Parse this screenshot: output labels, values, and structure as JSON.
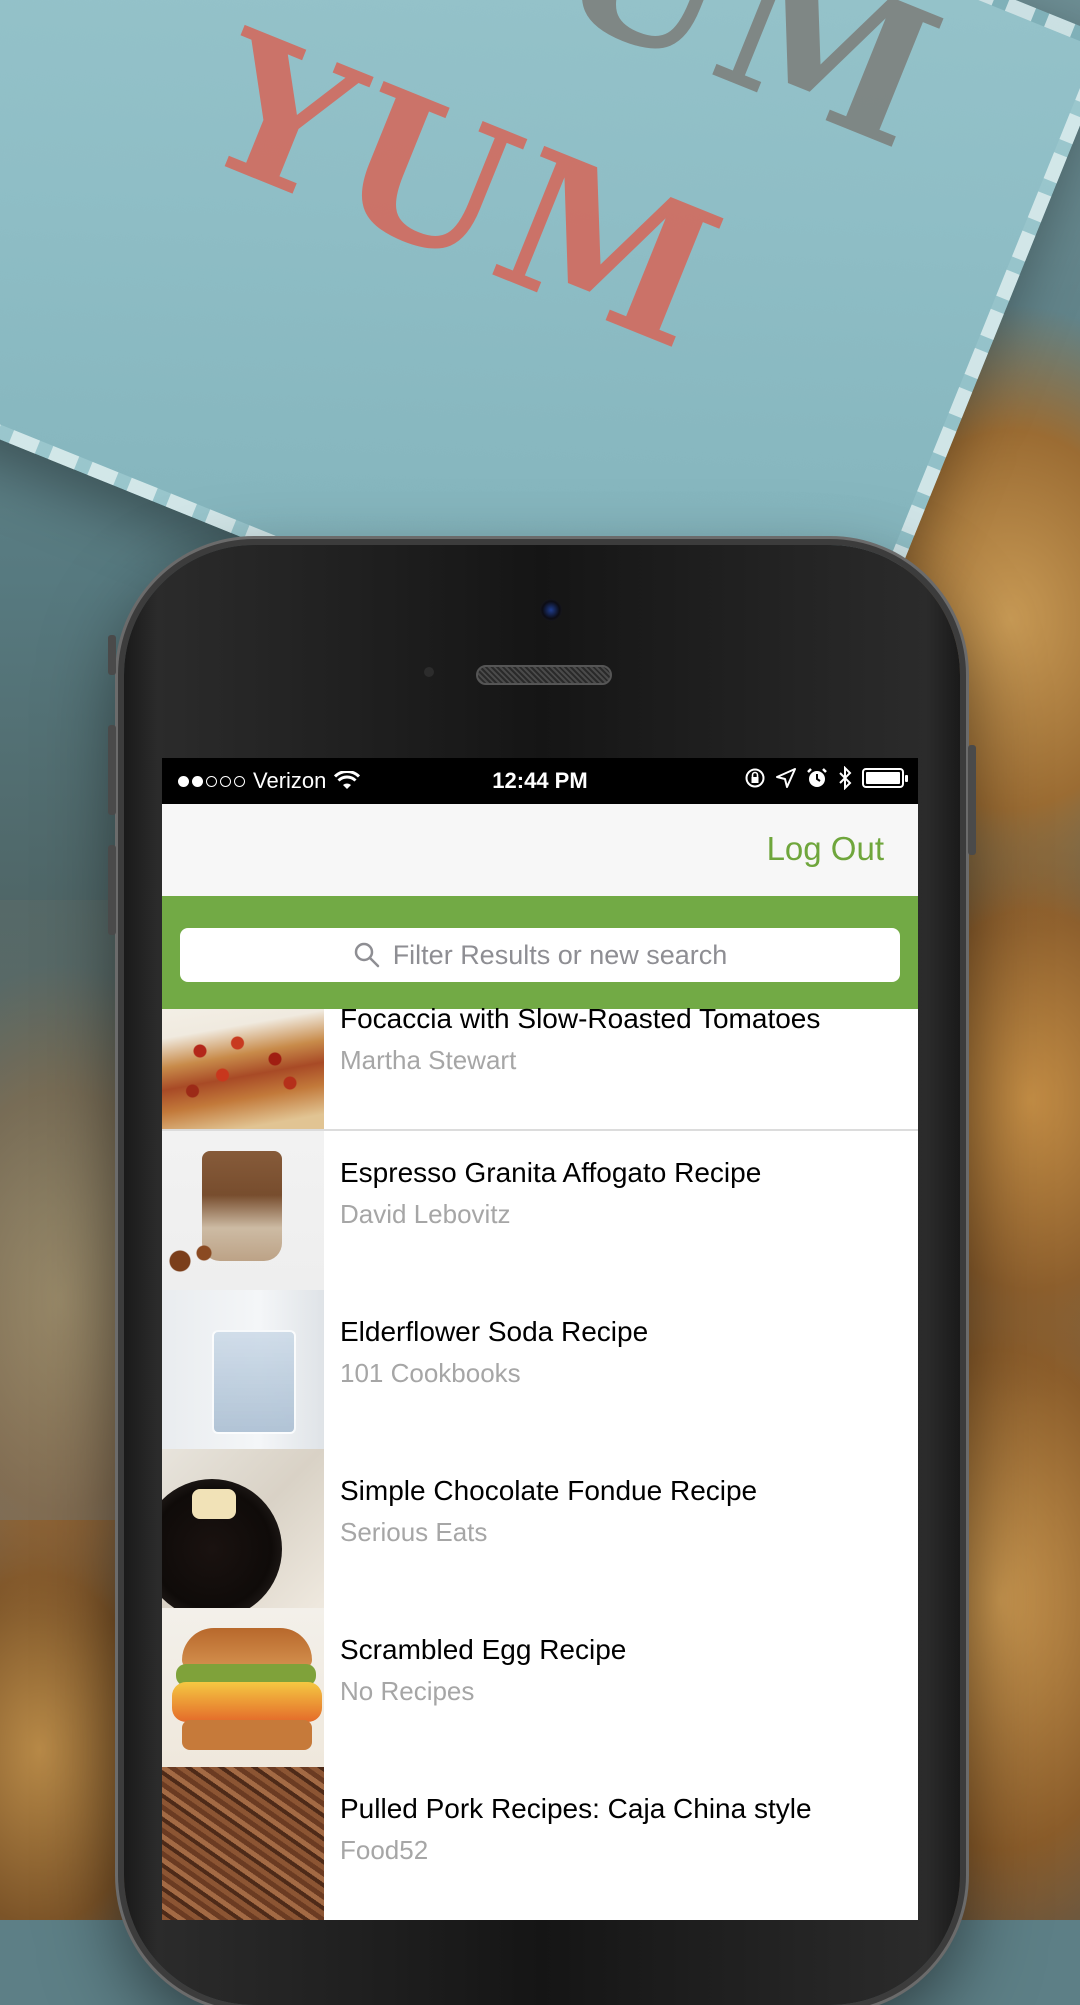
{
  "background": {
    "card_text_red": "YUM",
    "card_text_grey": "YUM"
  },
  "status_bar": {
    "carrier": "Verizon",
    "time": "12:44 PM",
    "signal_bars_filled": 2,
    "signal_bars_total": 5,
    "battery_level": 1.0
  },
  "nav": {
    "logout_label": "Log Out"
  },
  "search": {
    "placeholder": "Filter Results or new search"
  },
  "recipes": [
    {
      "title": "Focaccia with Slow-Roasted Tomatoes",
      "source": "Martha Stewart"
    },
    {
      "title": "Espresso Granita Affogato Recipe",
      "source": "David Lebovitz"
    },
    {
      "title": "Elderflower Soda Recipe",
      "source": "101 Cookbooks"
    },
    {
      "title": "Simple Chocolate Fondue Recipe",
      "source": "Serious Eats"
    },
    {
      "title": "Scrambled Egg Recipe",
      "source": "No Recipes"
    },
    {
      "title": "Pulled Pork Recipes: Caja China style",
      "source": "Food52"
    }
  ],
  "colors": {
    "accent_green": "#72aa45",
    "logout_green": "#6fa63c",
    "subtitle_grey": "#a6a6a6"
  }
}
